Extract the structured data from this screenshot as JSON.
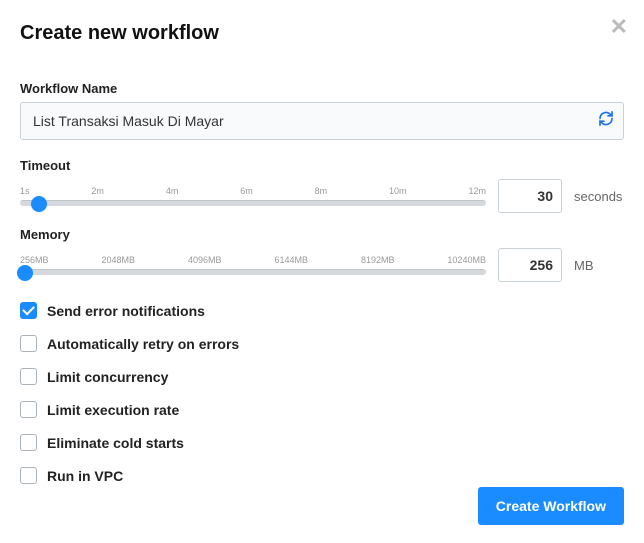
{
  "modal": {
    "title": "Create new workflow"
  },
  "workflowName": {
    "label": "Workflow Name",
    "value": "List Transaksi Masuk Di Mayar"
  },
  "timeout": {
    "label": "Timeout",
    "ticks": [
      "1s",
      "2m",
      "4m",
      "6m",
      "8m",
      "10m",
      "12m"
    ],
    "value": "30",
    "unit": "seconds",
    "thumbPercent": 4
  },
  "memory": {
    "label": "Memory",
    "ticks": [
      "256MB",
      "2048MB",
      "4096MB",
      "6144MB",
      "8192MB",
      "10240MB"
    ],
    "value": "256",
    "unit": "MB",
    "thumbPercent": 1
  },
  "options": [
    {
      "label": "Send error notifications",
      "checked": true
    },
    {
      "label": "Automatically retry on errors",
      "checked": false
    },
    {
      "label": "Limit concurrency",
      "checked": false
    },
    {
      "label": "Limit execution rate",
      "checked": false
    },
    {
      "label": "Eliminate cold starts",
      "checked": false
    },
    {
      "label": "Run in VPC",
      "checked": false
    }
  ],
  "submit": {
    "label": "Create Workflow"
  }
}
